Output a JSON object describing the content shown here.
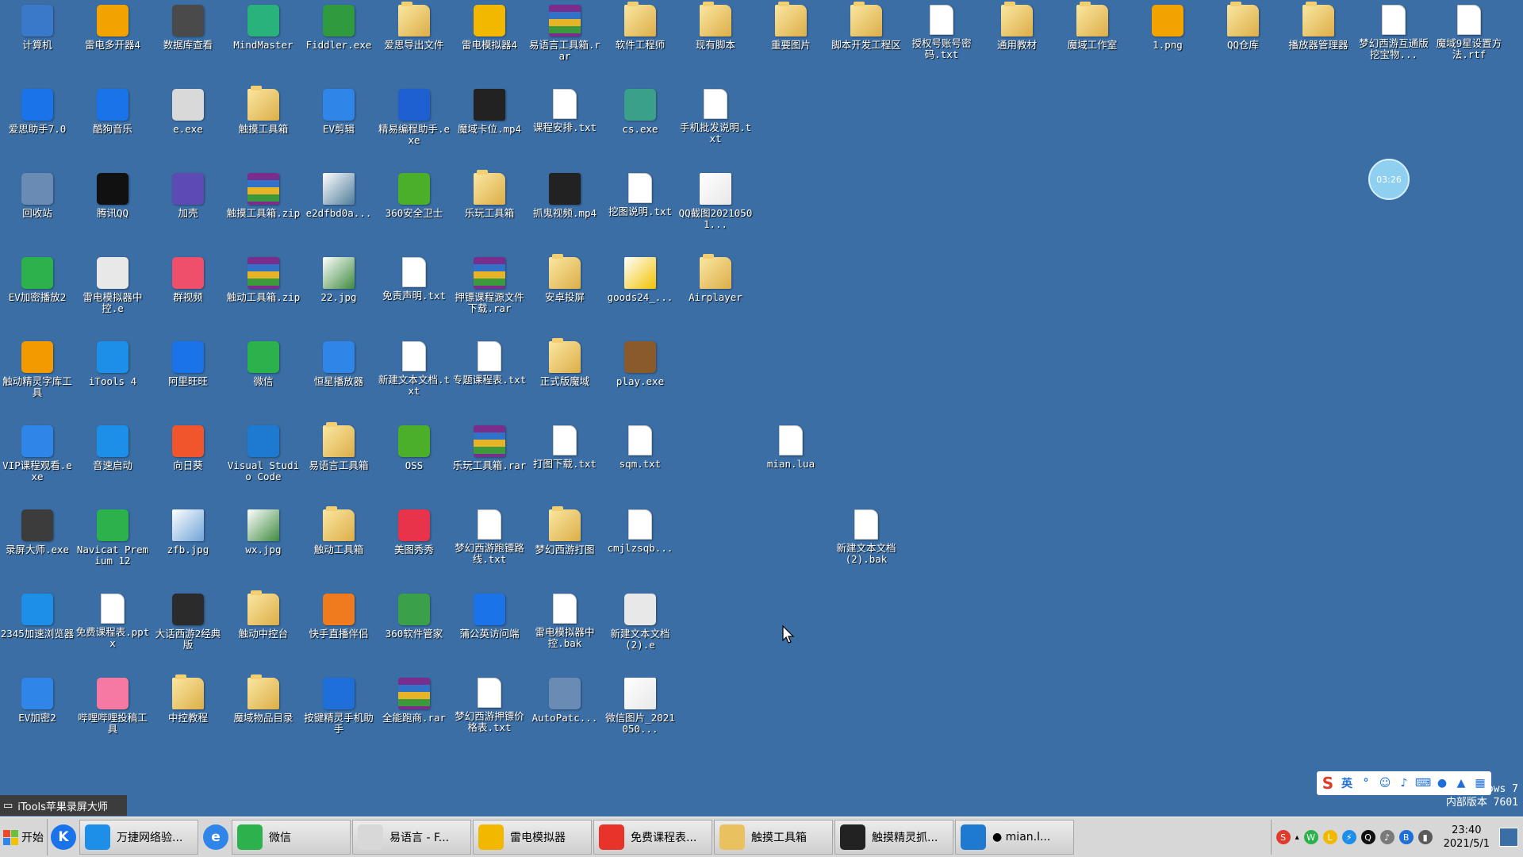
{
  "desktop": {
    "icons": [
      {
        "label": "计算机",
        "icon": "computer-icon",
        "kind": "app",
        "color": "#3a79c9"
      },
      {
        "label": "雷电多开器4",
        "icon": "ldmulti-icon",
        "kind": "app",
        "color": "#f2a300"
      },
      {
        "label": "数据库查看",
        "icon": "database-viewer-icon",
        "kind": "app",
        "color": "#4a4a4a"
      },
      {
        "label": "MindMaster",
        "icon": "mindmaster-icon",
        "kind": "app",
        "color": "#2ab27b"
      },
      {
        "label": "Fiddler.exe",
        "icon": "fiddler-icon",
        "kind": "app",
        "color": "#2f9b3e"
      },
      {
        "label": "爱思导出文件",
        "icon": "folder-icon",
        "kind": "folder",
        "color": "#e9c15f"
      },
      {
        "label": "雷电模拟器4",
        "icon": "ldplayer-icon",
        "kind": "app",
        "color": "#f2b800"
      },
      {
        "label": "易语言工具箱.rar",
        "icon": "archive-icon",
        "kind": "archive",
        "color": "#7b2d8e"
      },
      {
        "label": "软件工程师",
        "icon": "folder-icon",
        "kind": "folder",
        "color": "#e9c15f"
      },
      {
        "label": "现有脚本",
        "icon": "folder-icon",
        "kind": "folder",
        "color": "#e9c15f"
      },
      {
        "label": "重要图片",
        "icon": "folder-icon",
        "kind": "folder",
        "color": "#e9c15f"
      },
      {
        "label": "脚本开发工程区",
        "icon": "folder-icon",
        "kind": "folder",
        "color": "#e9c15f"
      },
      {
        "label": "授权号账号密码.txt",
        "icon": "text-file-icon",
        "kind": "doc",
        "color": "#ffffff"
      },
      {
        "label": "通用教材",
        "icon": "folder-icon",
        "kind": "folder",
        "color": "#e9c15f"
      },
      {
        "label": "魔域工作室",
        "icon": "folder-icon",
        "kind": "folder",
        "color": "#e9c15f"
      },
      {
        "label": "1.png",
        "icon": "pointing-hand-icon",
        "kind": "app",
        "color": "#f2a300"
      },
      {
        "label": "QQ仓库",
        "icon": "folder-icon",
        "kind": "folder",
        "color": "#e9c15f"
      },
      {
        "label": "播放器管理器",
        "icon": "folder-icon",
        "kind": "folder",
        "color": "#e9c15f"
      },
      {
        "label": "梦幻西游互通版挖宝物...",
        "icon": "text-file-icon",
        "kind": "doc",
        "color": "#ffffff"
      },
      {
        "label": "魔域9星设置方法.rtf",
        "icon": "word-doc-icon",
        "kind": "doc",
        "color": "#ffffff"
      },
      {
        "label": "爱思助手7.0",
        "icon": "i4-icon",
        "kind": "app",
        "color": "#1a73e8"
      },
      {
        "label": "酷狗音乐",
        "icon": "kugou-icon",
        "kind": "app",
        "color": "#1a73e8"
      },
      {
        "label": "e.exe",
        "icon": "e-exe-icon",
        "kind": "app",
        "color": "#d9d9d9"
      },
      {
        "label": "触摸工具箱",
        "icon": "folder-icon",
        "kind": "folder",
        "color": "#e9c15f"
      },
      {
        "label": "EV剪辑",
        "icon": "ev-edit-icon",
        "kind": "app",
        "color": "#2f86e8"
      },
      {
        "label": "精易编程助手.exe",
        "icon": "jingyi-icon",
        "kind": "app",
        "color": "#1e5fd1"
      },
      {
        "label": "魔域卡位.mp4",
        "icon": "video-icon",
        "kind": "video",
        "color": "#222222"
      },
      {
        "label": "课程安排.txt",
        "icon": "text-file-icon",
        "kind": "doc",
        "color": "#ffffff"
      },
      {
        "label": "cs.exe",
        "icon": "cs-exe-icon",
        "kind": "app",
        "color": "#3aa08a"
      },
      {
        "label": "手机批发说明.txt",
        "icon": "text-file-icon",
        "kind": "doc",
        "color": "#ffffff"
      },
      {
        "label": "回收站",
        "icon": "recycle-bin-icon",
        "kind": "app",
        "color": "#6a8bb3"
      },
      {
        "label": "腾讯QQ",
        "icon": "qq-icon",
        "kind": "app",
        "color": "#111111"
      },
      {
        "label": "加壳",
        "icon": "packer-icon",
        "kind": "app",
        "color": "#5d4bb3"
      },
      {
        "label": "触摸工具箱.zip",
        "icon": "archive-icon",
        "kind": "archive",
        "color": "#7b2d8e"
      },
      {
        "label": "e2dfbd0a...",
        "icon": "image-icon",
        "kind": "image",
        "color": "#4f7c9a"
      },
      {
        "label": "360安全卫士",
        "icon": "360-icon",
        "kind": "app",
        "color": "#4caf2a"
      },
      {
        "label": "乐玩工具箱",
        "icon": "folder-icon",
        "kind": "folder",
        "color": "#e9c15f"
      },
      {
        "label": "抓鬼视频.mp4",
        "icon": "video-icon",
        "kind": "video",
        "color": "#222222"
      },
      {
        "label": "挖图说明.txt",
        "icon": "text-file-icon",
        "kind": "doc",
        "color": "#ffffff"
      },
      {
        "label": "QQ截图20210501...",
        "icon": "image-icon",
        "kind": "image",
        "color": "#e8e8e8"
      },
      {
        "label": "EV加密播放2",
        "icon": "ev-player-icon",
        "kind": "app",
        "color": "#2bb24c"
      },
      {
        "label": "雷电模拟器中控.e",
        "icon": "e-source-icon",
        "kind": "app",
        "color": "#e8e8e8"
      },
      {
        "label": "群视频",
        "icon": "group-video-icon",
        "kind": "app",
        "color": "#f04f6b"
      },
      {
        "label": "触动工具箱.zip",
        "icon": "archive-icon",
        "kind": "archive",
        "color": "#7b2d8e"
      },
      {
        "label": "22.jpg",
        "icon": "qr-image-icon",
        "kind": "image",
        "color": "#3f8a3f"
      },
      {
        "label": "免责声明.txt",
        "icon": "text-file-icon",
        "kind": "doc",
        "color": "#ffffff"
      },
      {
        "label": "押镖课程源文件下载.rar",
        "icon": "archive-icon",
        "kind": "archive",
        "color": "#7b2d8e"
      },
      {
        "label": "安卓投屏",
        "icon": "folder-icon",
        "kind": "folder",
        "color": "#e9c15f"
      },
      {
        "label": "goods24_...",
        "icon": "image-icon",
        "kind": "image",
        "color": "#f2c200"
      },
      {
        "label": "Airplayer",
        "icon": "folder-icon",
        "kind": "folder",
        "color": "#e9c15f"
      },
      {
        "label": "触动精灵字库工具",
        "icon": "font-tool-icon",
        "kind": "app",
        "color": "#f29a00"
      },
      {
        "label": "iTools 4",
        "icon": "itools-icon",
        "kind": "app",
        "color": "#1e8fe8"
      },
      {
        "label": "阿里旺旺",
        "icon": "aliwangwang-icon",
        "kind": "app",
        "color": "#1a73e8"
      },
      {
        "label": "微信",
        "icon": "wechat-icon",
        "kind": "app",
        "color": "#2bb24c"
      },
      {
        "label": "恒星播放器",
        "icon": "player-icon",
        "kind": "app",
        "color": "#2f86e8"
      },
      {
        "label": "新建文本文档.txt",
        "icon": "text-file-icon",
        "kind": "doc",
        "color": "#ffffff"
      },
      {
        "label": "专题课程表.txt",
        "icon": "text-file-icon",
        "kind": "doc",
        "color": "#ffffff"
      },
      {
        "label": "正式版魔域",
        "icon": "folder-icon",
        "kind": "folder",
        "color": "#e9c15f"
      },
      {
        "label": "play.exe",
        "icon": "game-icon",
        "kind": "app",
        "color": "#8b5a2b"
      },
      {
        "label": "VIP课程观看.exe",
        "icon": "ev-vip-icon",
        "kind": "app",
        "color": "#2f86e8"
      },
      {
        "label": "音速启动",
        "icon": "yinsu-icon",
        "kind": "app",
        "color": "#1e8fe8"
      },
      {
        "label": "向日葵",
        "icon": "sunflower-icon",
        "kind": "app",
        "color": "#f0552b"
      },
      {
        "label": "Visual Studio Code",
        "icon": "vscode-icon",
        "kind": "app",
        "color": "#1e7ad1"
      },
      {
        "label": "易语言工具箱",
        "icon": "folder-icon",
        "kind": "folder",
        "color": "#e9c15f"
      },
      {
        "label": "OSS",
        "icon": "oss-icon",
        "kind": "app",
        "color": "#4caf2a"
      },
      {
        "label": "乐玩工具箱.rar",
        "icon": "archive-icon",
        "kind": "archive",
        "color": "#7b2d8e"
      },
      {
        "label": "打图下载.txt",
        "icon": "text-file-icon",
        "kind": "doc",
        "color": "#ffffff"
      },
      {
        "label": "sqm.txt",
        "icon": "text-file-icon",
        "kind": "doc",
        "color": "#ffffff"
      },
      {
        "label": "mian.lua",
        "icon": "text-file-icon",
        "kind": "doc",
        "color": "#ffffff"
      },
      {
        "label": "录屏大师.exe",
        "icon": "screen-record-icon",
        "kind": "app",
        "color": "#3c3c3c"
      },
      {
        "label": "Navicat Premium 12",
        "icon": "navicat-icon",
        "kind": "app",
        "color": "#2bb24c"
      },
      {
        "label": "zfb.jpg",
        "icon": "image-icon",
        "kind": "image",
        "color": "#6fa3d8"
      },
      {
        "label": "wx.jpg",
        "icon": "qr-image-icon",
        "kind": "image",
        "color": "#3f8a3f"
      },
      {
        "label": "触动工具箱",
        "icon": "folder-icon",
        "kind": "folder",
        "color": "#e9c15f"
      },
      {
        "label": "美图秀秀",
        "icon": "meitu-icon",
        "kind": "app",
        "color": "#e8334a"
      },
      {
        "label": "梦幻西游跑镖路线.txt",
        "icon": "text-file-icon",
        "kind": "doc",
        "color": "#ffffff"
      },
      {
        "label": "梦幻西游打图",
        "icon": "folder-icon",
        "kind": "folder",
        "color": "#e9c15f"
      },
      {
        "label": "cmjlzsqb...",
        "icon": "text-file-icon",
        "kind": "doc",
        "color": "#ffffff"
      },
      {
        "label": "新建文本文档(2).bak",
        "icon": "text-file-icon",
        "kind": "doc",
        "color": "#ffffff"
      },
      {
        "label": "2345加速浏览器",
        "icon": "browser-2345-icon",
        "kind": "app",
        "color": "#1e8fe8"
      },
      {
        "label": "免费课程表.pptx",
        "icon": "ppt-file-icon",
        "kind": "doc",
        "color": "#ffffff"
      },
      {
        "label": "大话西游2经典版",
        "icon": "dahua-icon",
        "kind": "app",
        "color": "#2b2b2b"
      },
      {
        "label": "触动中控台",
        "icon": "folder-icon",
        "kind": "folder",
        "color": "#e9c15f"
      },
      {
        "label": "快手直播伴侣",
        "icon": "kuaishou-icon",
        "kind": "app",
        "color": "#f07a1e"
      },
      {
        "label": "360软件管家",
        "icon": "360-manager-icon",
        "kind": "app",
        "color": "#3aa04a"
      },
      {
        "label": "蒲公英访问端",
        "icon": "pugongying-icon",
        "kind": "app",
        "color": "#1a73e8"
      },
      {
        "label": "雷电模拟器中控.bak",
        "icon": "text-file-icon",
        "kind": "doc",
        "color": "#ffffff"
      },
      {
        "label": "新建文本文档(2).e",
        "icon": "e-source-icon",
        "kind": "app",
        "color": "#e8e8e8"
      },
      {
        "label": "EV加密2",
        "icon": "ev-encrypt-icon",
        "kind": "app",
        "color": "#2f86e8"
      },
      {
        "label": "哔哩哔哩投稿工具",
        "icon": "bilibili-icon",
        "kind": "app",
        "color": "#f57aa3"
      },
      {
        "label": "中控教程",
        "icon": "folder-icon",
        "kind": "folder",
        "color": "#e9c15f"
      },
      {
        "label": "魔域物品目录",
        "icon": "folder-icon",
        "kind": "folder",
        "color": "#e9c15f"
      },
      {
        "label": "按键精灵手机助手",
        "icon": "anjian-icon",
        "kind": "app",
        "color": "#1e6fd9"
      },
      {
        "label": "全能跑商.rar",
        "icon": "archive-icon",
        "kind": "archive",
        "color": "#7b2d8e"
      },
      {
        "label": "梦幻西游押镖价格表.txt",
        "icon": "text-file-icon",
        "kind": "doc",
        "color": "#ffffff"
      },
      {
        "label": "AutoPatc...",
        "icon": "autopatch-icon",
        "kind": "app",
        "color": "#6a8bb3"
      },
      {
        "label": "微信图片_2021050...",
        "icon": "image-icon",
        "kind": "image",
        "color": "#e8e8e8"
      }
    ]
  },
  "clock_bubble": "03:26",
  "watermark": {
    "line1": "Windows 7",
    "line2": "内部版本 7601"
  },
  "ime": {
    "brand": "S",
    "lang": "英"
  },
  "recording_overlay": "iTools苹果录屏大师",
  "taskbar": {
    "start_label": "开始",
    "buttons": [
      {
        "label": "万捷网络验...",
        "icon": "wanjie-icon",
        "color": "#1e8fe8"
      },
      {
        "label": "微信",
        "icon": "wechat-icon",
        "color": "#2bb24c"
      },
      {
        "label": "易语言 - F...",
        "icon": "eyuyan-icon",
        "color": "#d8d8d8"
      },
      {
        "label": "雷电模拟器",
        "icon": "ldplayer-icon",
        "color": "#f2b800"
      },
      {
        "label": "免费课程表...",
        "icon": "wps-icon",
        "color": "#e8332a"
      },
      {
        "label": "触摸工具箱",
        "icon": "folder-icon",
        "color": "#e9c15f"
      },
      {
        "label": "触摸精灵抓...",
        "icon": "touch-sprite-icon",
        "color": "#222222"
      },
      {
        "label": "● mian.l...",
        "icon": "vscode-icon",
        "color": "#1e7ad1"
      }
    ],
    "clock_time": "23:40",
    "clock_date": "2021/5/1"
  }
}
